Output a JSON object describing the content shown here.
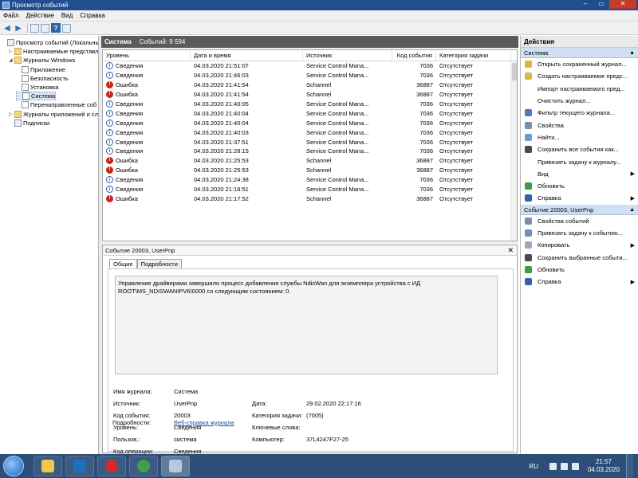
{
  "window": {
    "title": "Просмотр событий"
  },
  "menu": [
    "Файл",
    "Действие",
    "Вид",
    "Справка"
  ],
  "tree": {
    "items": [
      {
        "label": "Просмотр событий (Локальны",
        "indent": 0,
        "tri": "",
        "icon": "box"
      },
      {
        "label": "Настраиваемые представле",
        "indent": 1,
        "tri": "▷",
        "icon": "folder"
      },
      {
        "label": "Журналы Windows",
        "indent": 1,
        "tri": "◢",
        "icon": "folder"
      },
      {
        "label": "Приложение",
        "indent": 2,
        "tri": "",
        "icon": "log"
      },
      {
        "label": "Безопасность",
        "indent": 2,
        "tri": "",
        "icon": "log"
      },
      {
        "label": "Установка",
        "indent": 2,
        "tri": "",
        "icon": "log"
      },
      {
        "label": "Система",
        "indent": 2,
        "tri": "",
        "icon": "log",
        "selected": true
      },
      {
        "label": "Перенаправленные соб",
        "indent": 2,
        "tri": "",
        "icon": "log"
      },
      {
        "label": "Журналы приложений и сл",
        "indent": 1,
        "tri": "▷",
        "icon": "folder"
      },
      {
        "label": "Подписки",
        "indent": 1,
        "tri": "",
        "icon": "box"
      }
    ]
  },
  "log": {
    "name": "Система",
    "count": "Событий: 9 594"
  },
  "grid": {
    "columns": [
      "Уровень",
      "Дата и время",
      "Источник",
      "Код события",
      "Категория задачи"
    ],
    "rows": [
      [
        "Сведения",
        "04.03.2020 21:51:07",
        "Service Control Mana...",
        "7036",
        "Отсутствует",
        "info"
      ],
      [
        "Сведения",
        "04.03.2020 21:46:03",
        "Service Control Mana...",
        "7036",
        "Отсутствует",
        "info"
      ],
      [
        "Ошибка",
        "04.03.2020 21:41:54",
        "Schannel",
        "36887",
        "Отсутствует",
        "err"
      ],
      [
        "Ошибка",
        "04.03.2020 21:41:54",
        "Schannel",
        "36887",
        "Отсутствует",
        "err"
      ],
      [
        "Сведения",
        "04.03.2020 21:40:05",
        "Service Control Mana...",
        "7036",
        "Отсутствует",
        "info"
      ],
      [
        "Сведения",
        "04.03.2020 21:40:04",
        "Service Control Mana...",
        "7036",
        "Отсутствует",
        "info"
      ],
      [
        "Сведения",
        "04.03.2020 21:40:04",
        "Service Control Mana...",
        "7036",
        "Отсутствует",
        "info"
      ],
      [
        "Сведения",
        "04.03.2020 21:40:03",
        "Service Control Mana...",
        "7036",
        "Отсутствует",
        "info"
      ],
      [
        "Сведения",
        "04.03.2020 21:37:51",
        "Service Control Mana...",
        "7036",
        "Отсутствует",
        "info"
      ],
      [
        "Сведения",
        "04.03.2020 21:28:15",
        "Service Control Mana...",
        "7036",
        "Отсутствует",
        "info"
      ],
      [
        "Ошибка",
        "04.03.2020 21:25:53",
        "Schannel",
        "36887",
        "Отсутствует",
        "err"
      ],
      [
        "Ошибка",
        "04.03.2020 21:25:53",
        "Schannel",
        "36887",
        "Отсутствует",
        "err"
      ],
      [
        "Сведения",
        "04.03.2020 21:24:38",
        "Service Control Mana...",
        "7036",
        "Отсутствует",
        "info"
      ],
      [
        "Сведения",
        "04.03.2020 21:18:51",
        "Service Control Mana...",
        "7036",
        "Отсутствует",
        "info"
      ],
      [
        "Ошибка",
        "04.03.2020 21:17:52",
        "Schannel",
        "36887",
        "Отсутствует",
        "err"
      ]
    ]
  },
  "detail": {
    "header": "Событие 20003, UserPnp",
    "tabs": [
      "Общие",
      "Подробности"
    ],
    "message": "Управление драйверами завершило процесс добавления службы NdisWan для экземпляра устройства с ИД ROOT\\MS_NDISWANIPV6\\0000 со следующим состоянием: 0.",
    "fields": {
      "journal_label": "Имя журнала:",
      "journal": "Система",
      "source_label": "Источник:",
      "source": "UserPnp",
      "date_label": "Дата:",
      "date": "29.02.2020 22:17:16",
      "code_label": "Код события:",
      "code": "20003",
      "category_label": "Категория задачи:",
      "category": "(7005)",
      "level_label": "Уровень:",
      "level": "Сведения",
      "keywords_label": "Ключевые слова:",
      "keywords": "",
      "user_label": "Пользов.:",
      "user": "система",
      "computer_label": "Компьютер:",
      "computer": "37L4247F27-25",
      "opcode_label": "Код операции:",
      "opcode": "Сведения",
      "more_label": "Подробности:",
      "more_link": "Веб-справка журнала"
    }
  },
  "actions": {
    "title": "Действия",
    "section1": "Система",
    "items1": [
      {
        "label": "Открыть сохраненный журнал...",
        "color": "#e0b440",
        "sub": ""
      },
      {
        "label": "Создать настраиваемое предс...",
        "color": "#e0b440",
        "sub": ""
      },
      {
        "label": "Импорт настраиваемого пред...",
        "color": "#ffffff",
        "sub": ""
      },
      {
        "label": "Очистить журнал...",
        "color": "#ffffff",
        "sub": ""
      },
      {
        "label": "Фильтр текущего журнала...",
        "color": "#4f7cbc",
        "sub": ""
      },
      {
        "label": "Свойства",
        "color": "#7d8fa6",
        "sub": ""
      },
      {
        "label": "Найти...",
        "color": "#6a9bd1",
        "sub": ""
      },
      {
        "label": "Сохранить все события как...",
        "color": "#4a4a4a",
        "sub": ""
      },
      {
        "label": "Привязать задачу к журналу...",
        "color": "#ffffff",
        "sub": ""
      },
      {
        "label": "Вид",
        "color": "#ffffff",
        "sub": "▶"
      },
      {
        "label": "Обновить",
        "color": "#3f9a4a",
        "sub": ""
      },
      {
        "label": "Справка",
        "color": "#2f63b0",
        "sub": "▶"
      }
    ],
    "section2": "Событие 20003, UserPnp",
    "items2": [
      {
        "label": "Свойства событий",
        "color": "#7d8fa6",
        "sub": ""
      },
      {
        "label": "Привязать задачу к событию...",
        "color": "#6f8fb8",
        "sub": ""
      },
      {
        "label": "Копировать",
        "color": "#9aa9bb",
        "sub": "▶"
      },
      {
        "label": "Сохранить выбранные событи...",
        "color": "#4a4a4a",
        "sub": ""
      },
      {
        "label": "Обновить",
        "color": "#3f9a4a",
        "sub": ""
      },
      {
        "label": "Справка",
        "color": "#2f63b0",
        "sub": "▶"
      }
    ]
  },
  "taskbar": {
    "apps": [
      {
        "name": "explorer",
        "color": "#f1c84b"
      },
      {
        "name": "libreoffice",
        "color": "#1f6fbf"
      },
      {
        "name": "opera",
        "color": "#d22a2a"
      },
      {
        "name": "chrome",
        "color": "#3fa04a"
      },
      {
        "name": "event-viewer",
        "color": "#b7c9dc",
        "active": true
      }
    ],
    "lang": "RU",
    "time": "21:57",
    "date": "04.03.2020"
  }
}
